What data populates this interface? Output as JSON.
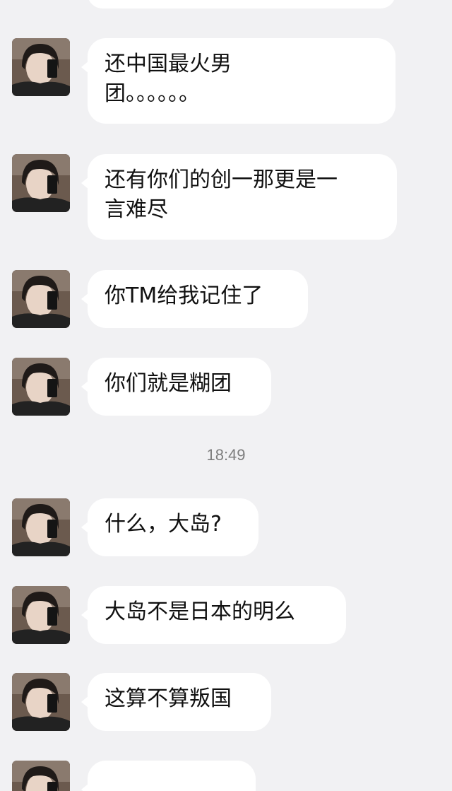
{
  "chat": {
    "timestamp": "18:49",
    "messages": [
      {
        "text": "还中国最火男\n团。。。。。。"
      },
      {
        "text": "还有你们的创一那更是一\n言难尽"
      },
      {
        "text": "你TM给我记住了"
      },
      {
        "text": "你们就是糊团"
      },
      {
        "text": "什么，大岛?"
      },
      {
        "text": "大岛不是日本的明么"
      },
      {
        "text": "这算不算叛国"
      },
      {
        "text": ""
      }
    ]
  }
}
